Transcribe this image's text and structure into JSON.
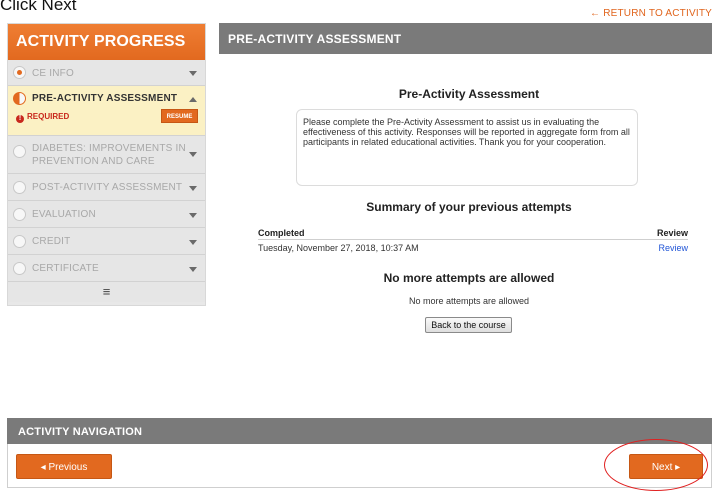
{
  "instruction": "Click Next",
  "return_link": "← RETURN TO ACTIVITY",
  "sidebar": {
    "title": "ACTIVITY PROGRESS",
    "items": [
      {
        "label": "CE INFO"
      },
      {
        "label": "PRE-ACTIVITY ASSESSMENT",
        "required": "REQUIRED",
        "button": "RESUME"
      },
      {
        "label_line1": "DIABETES: IMPROVEMENTS IN",
        "label_line2": "PREVENTION AND CARE"
      },
      {
        "label": "POST-ACTIVITY ASSESSMENT"
      },
      {
        "label": "EVALUATION"
      },
      {
        "label": "CREDIT"
      },
      {
        "label": "CERTIFICATE"
      }
    ],
    "menu_icon": "≡"
  },
  "main": {
    "header": "PRE-ACTIVITY ASSESSMENT",
    "title": "Pre-Activity Assessment",
    "intro": "Please complete the Pre-Activity Assessment to assist us in evaluating the effectiveness of this activity. Responses will be reported in aggregate form from all participants in related educational activities. Thank you for your cooperation.",
    "summary_title": "Summary of your previous attempts",
    "table": {
      "col_completed": "Completed",
      "col_review": "Review",
      "rows": [
        {
          "completed": "Tuesday, November 27, 2018, 10:37 AM",
          "review": "Review"
        }
      ]
    },
    "no_more_title": "No more attempts are allowed",
    "no_more_text": "No more attempts are allowed",
    "back_button": "Back to the course"
  },
  "navigation": {
    "header": "ACTIVITY NAVIGATION",
    "previous": "◂ Previous",
    "next": "Next ▸"
  },
  "colors": {
    "accent": "#e2691f",
    "header_gray": "#7a7a7a",
    "annotation": "#e02020"
  }
}
